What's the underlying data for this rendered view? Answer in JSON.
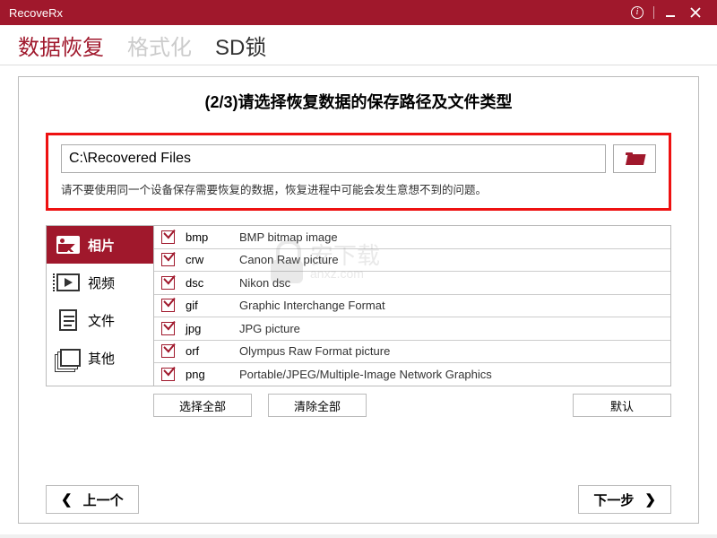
{
  "app": {
    "title": "RecoveRx"
  },
  "tabs": {
    "recover": "数据恢复",
    "format": "格式化",
    "sdlock": "SD锁"
  },
  "heading": "(2/3)请选择恢复数据的保存路径及文件类型",
  "path": {
    "value": "C:\\Recovered Files",
    "warning": "请不要使用同一个设备保存需要恢复的数据，恢复进程中可能会发生意想不到的问题。"
  },
  "categories": {
    "photo": "相片",
    "video": "视频",
    "doc": "文件",
    "other": "其他"
  },
  "formats": [
    {
      "ext": "bmp",
      "desc": "BMP bitmap image"
    },
    {
      "ext": "crw",
      "desc": "Canon Raw picture"
    },
    {
      "ext": "dsc",
      "desc": "Nikon dsc"
    },
    {
      "ext": "gif",
      "desc": "Graphic Interchange Format"
    },
    {
      "ext": "jpg",
      "desc": "JPG picture"
    },
    {
      "ext": "orf",
      "desc": "Olympus Raw Format picture"
    },
    {
      "ext": "png",
      "desc": "Portable/JPEG/Multiple-Image Network Graphics"
    }
  ],
  "buttons": {
    "select_all": "选择全部",
    "clear_all": "清除全部",
    "defaults": "默认",
    "prev": "上一个",
    "next": "下一步"
  },
  "watermark": {
    "t1": "安下载",
    "t2": "anxz.com"
  }
}
